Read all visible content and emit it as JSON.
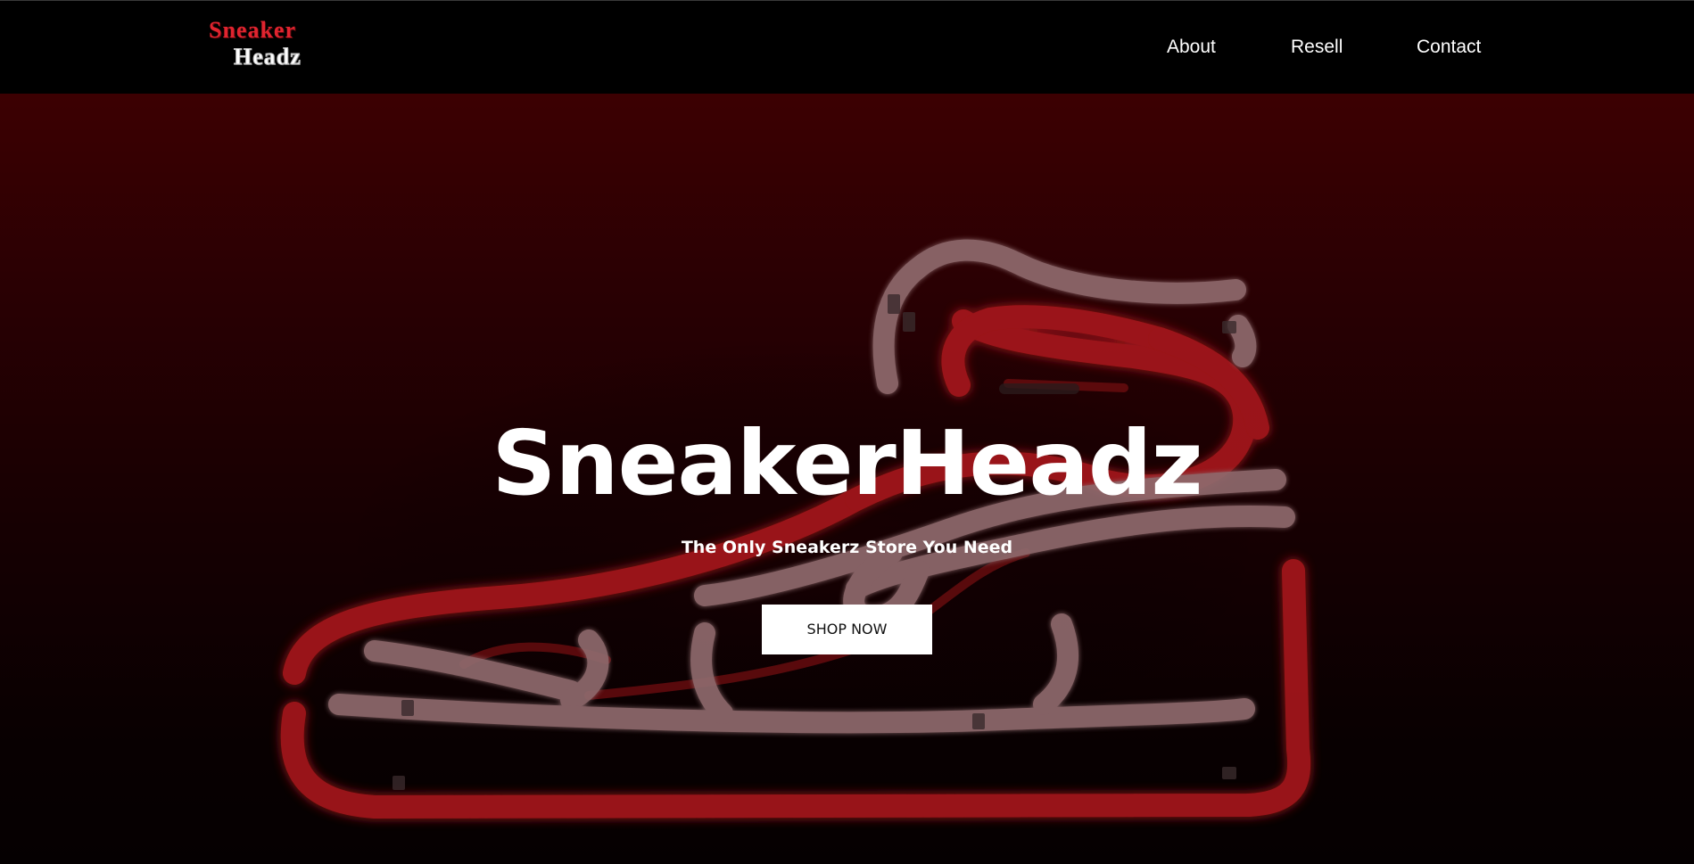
{
  "header": {
    "logo_line1": "Sneaker",
    "logo_line2": "Headz",
    "nav": [
      {
        "label": "About"
      },
      {
        "label": "Resell"
      },
      {
        "label": "Contact"
      }
    ]
  },
  "hero": {
    "title": "SneakerHeadz",
    "subtitle": "The Only Sneakerz Store You Need",
    "cta_label": "SHOP NOW",
    "background_image": "neon-sneaker-sign"
  },
  "colors": {
    "brand_red": "#e0242f",
    "nav_background": "#000000",
    "hero_top": "#3c0002",
    "hero_bottom": "#050001",
    "neon_red": "#c01a1c",
    "neon_white": "#8a6a6c"
  }
}
